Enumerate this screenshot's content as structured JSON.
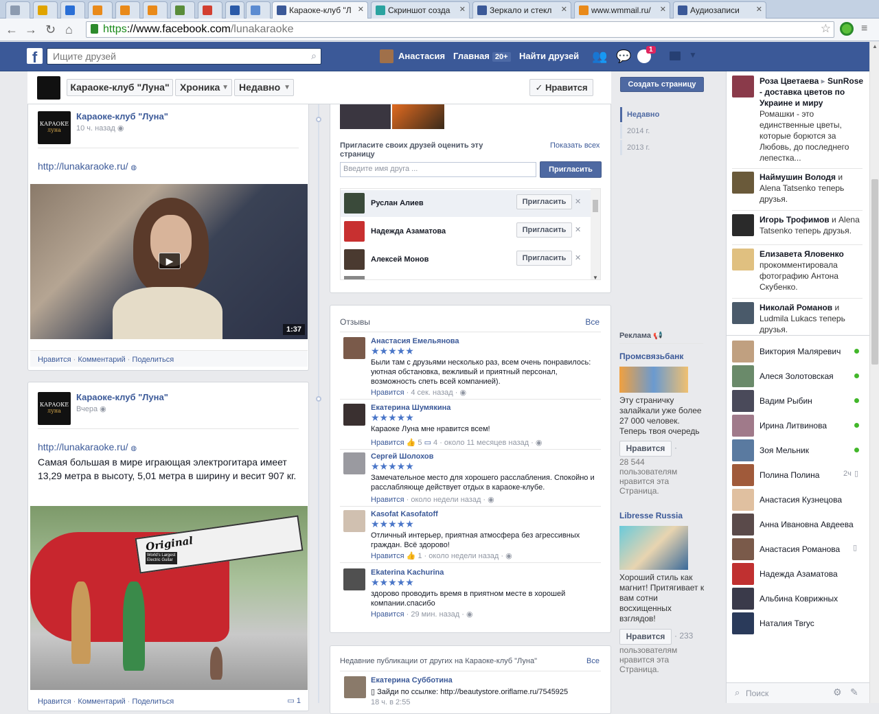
{
  "browser": {
    "tabs": [
      {
        "label": "",
        "color": "#8c9bb0"
      },
      {
        "label": "",
        "color": "#e0a400"
      },
      {
        "label": "",
        "color": "#2a6fd6"
      },
      {
        "label": "",
        "color": "#e98a1a"
      },
      {
        "label": "",
        "color": "#e98a1a"
      },
      {
        "label": "",
        "color": "#e98a1a"
      },
      {
        "label": "",
        "color": "#5a8d3a"
      },
      {
        "label": "",
        "color": "#d23f31"
      },
      {
        "label": "",
        "color": "#2a5aa8"
      },
      {
        "label": "",
        "color": "#5b8bd1"
      },
      {
        "label": "Караоке-клуб \"Л",
        "color": "#3b5998"
      },
      {
        "label": "Скриншот созда",
        "color": "#2aa3a0"
      },
      {
        "label": "Зеркало и стекл",
        "color": "#3b5998"
      },
      {
        "label": "www.wmmail.ru/",
        "color": "#e98a1a"
      },
      {
        "label": "Аудиозаписи",
        "color": "#3b5998"
      }
    ],
    "url_https": "https",
    "url_host": "://www.facebook.com",
    "url_path": "/lunakaraoke"
  },
  "fb": {
    "search_placeholder": "Ищите друзей",
    "profile_name": "Анастасия",
    "home": "Главная",
    "home_badge": "20+",
    "find_friends": "Найти друзей",
    "notif_count": "1"
  },
  "page_header": {
    "page_name": "Караоке-клуб \"Луна\"",
    "timeline": "Хроника",
    "recent": "Недавно",
    "like_button": "✓ Нравится"
  },
  "posts": [
    {
      "author": "Караоке-клуб \"Луна\"",
      "time": "10 ч. назад",
      "link": "http://lunakaraoke.ru/",
      "text": "",
      "video_duration": "1:37",
      "actions": [
        "Нравится",
        "Комментарий",
        "Поделиться"
      ]
    },
    {
      "author": "Караоке-клуб \"Луна\"",
      "time": "Вчера",
      "link": "http://lunakaraoke.ru/",
      "text": "Самая большая в мире играющая электрогитара имеет 13,29 метра в высоту, 5,01 метра в ширину и весит 907 кг.",
      "actions": [
        "Нравится",
        "Комментарий",
        "Поделиться"
      ],
      "comment_count": "1",
      "guitar_word": "Original",
      "guitar_caption": "World's Largest Electric Guitar"
    }
  ],
  "invite": {
    "title": "Пригласите своих друзей оценить эту страницу",
    "show_all": "Показать всех",
    "input_placeholder": "Введите имя друга ...",
    "invite_button": "Пригласить",
    "friends": [
      {
        "name": "Руслан Алиев",
        "button": "Пригласить"
      },
      {
        "name": "Надежда Азаматова",
        "button": "Пригласить"
      },
      {
        "name": "Алексей Монов",
        "button": "Пригласить"
      }
    ]
  },
  "reviews": {
    "title": "Отзывы",
    "all": "Все",
    "items": [
      {
        "name": "Анастасия Емельянова",
        "stars": "★★★★★",
        "text": "Были там с друзьями несколько раз, всем очень понравилось: уютная обстановка, вежливый и приятный персонал, возможность спеть всей компанией).",
        "like": "Нравится",
        "meta": " · 4 сек. назад · "
      },
      {
        "name": "Екатерина Шумякина",
        "stars": "★★★★★",
        "text": "Караоке Луна мне нравится всем!",
        "like": "Нравится",
        "up": "5",
        "down": "4",
        "meta": " · около 11 месяцев назад · "
      },
      {
        "name": "Сергей Шолохов",
        "stars": "★★★★★",
        "text": "Замечательное место для хорошего расслабления. Спокойно и расслабляюще действует отдых в караоке-клубе.",
        "like": "Нравится",
        "meta": " · около недели назад · "
      },
      {
        "name": "Kasofat Kasofatoff",
        "stars": "★★★★★",
        "text": "Отличный интерьер, приятная атмосфера без агрессивных граждан. Всё здорово!",
        "like": "Нравится",
        "up": "1",
        "meta": " · около недели назад · "
      },
      {
        "name": "Ekaterina Kachurina",
        "stars": "★★★★★",
        "text": "здорово проводить время в приятном месте в хорошей компании.спасибо",
        "like": "Нравится",
        "meta": " · 29 мин. назад · "
      }
    ]
  },
  "recent_posts": {
    "title": "Недавние публикации от других на Караоке-клуб \"Луна\"",
    "all": "Все",
    "author": "Екатерина Субботина",
    "text": "Зайди по ссылке: http://beautystore.oriflame.ru/7545925",
    "time": "18 ч. в 2:55"
  },
  "timeline_nav": {
    "create_page": "Создать страницу",
    "years": [
      "Недавно",
      "2014 г.",
      "2013 г."
    ]
  },
  "ads": {
    "title": "Реклама",
    "items": [
      {
        "title": "Промсвязьбанк",
        "text": "Эту страничку залайкали уже более 27 000 человек. Теперь твоя очередь",
        "button": "Нравится",
        "likes": "28 544 пользователям нравится эта Страница.",
        "count_after": "·"
      },
      {
        "title": "Libresse Russia",
        "text": "Хороший стиль как магнит! Притягивает к вам сотни восхищенных взглядов!",
        "button": "Нравится",
        "count_after": "· 233",
        "likes": "пользователям нравится эта Страница."
      }
    ]
  },
  "ticker": [
    {
      "name": "Роза Цветаева",
      "arrow": "▸",
      "target": "SunRose - доставка цветов по Украине и миру",
      "text": "Ромашки - это единственные цветы, которые борются за Любовь, до последнего лепестка..."
    },
    {
      "name": "Наймушин Володя",
      "mid": " и ",
      "name2": "Alena Tatsenko",
      "text": " теперь друзья."
    },
    {
      "name": "Игорь Трофимов",
      "mid": " и ",
      "name2": "Alena Tatsenko",
      "text": " теперь друзья."
    },
    {
      "name": "Елизавета Яловенко",
      "text": "прокомментировала фотографию Антона Скубенко."
    },
    {
      "name": "Николай Романов",
      "mid": " и ",
      "name2": "Ludmila Lukacs",
      "text": " теперь друзья."
    }
  ],
  "chat": {
    "friends": [
      {
        "name": "Виктория Маляревич",
        "status": "online"
      },
      {
        "name": "Алеся Золотовская",
        "status": "online"
      },
      {
        "name": "Вадим Рыбин",
        "status": "online"
      },
      {
        "name": "Ирина Литвинова",
        "status": "online"
      },
      {
        "name": "Зоя Мельник",
        "status": "online"
      },
      {
        "name": "Полина Полина",
        "status": "2ч"
      },
      {
        "name": "Анастасия Кузнецова",
        "status": ""
      },
      {
        "name": "Анна Ивановна Авдеева",
        "status": ""
      },
      {
        "name": "Анастасия Романова",
        "status": "mobile"
      },
      {
        "name": "Надежда Азаматова",
        "status": ""
      },
      {
        "name": "Альбина Коврижных",
        "status": ""
      },
      {
        "name": "Наталия Твrус",
        "status": ""
      }
    ],
    "search_placeholder": "Поиск"
  }
}
